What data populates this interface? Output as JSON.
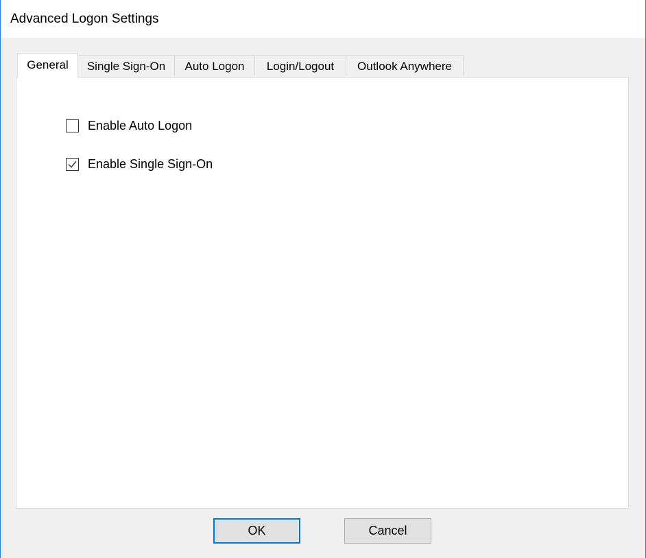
{
  "window": {
    "title": "Advanced Logon Settings"
  },
  "tabs": [
    {
      "label": "General",
      "selected": true
    },
    {
      "label": "Single Sign-On",
      "selected": false
    },
    {
      "label": "Auto Logon",
      "selected": false
    },
    {
      "label": "Login/Logout",
      "selected": false
    },
    {
      "label": "Outlook Anywhere",
      "selected": false
    }
  ],
  "general": {
    "enable_auto_logon": {
      "label": "Enable Auto Logon",
      "checked": false
    },
    "enable_single_sign_on": {
      "label": "Enable Single Sign-On",
      "checked": true
    }
  },
  "buttons": {
    "ok": "OK",
    "cancel": "Cancel"
  },
  "colors": {
    "accent": "#0078d7"
  }
}
